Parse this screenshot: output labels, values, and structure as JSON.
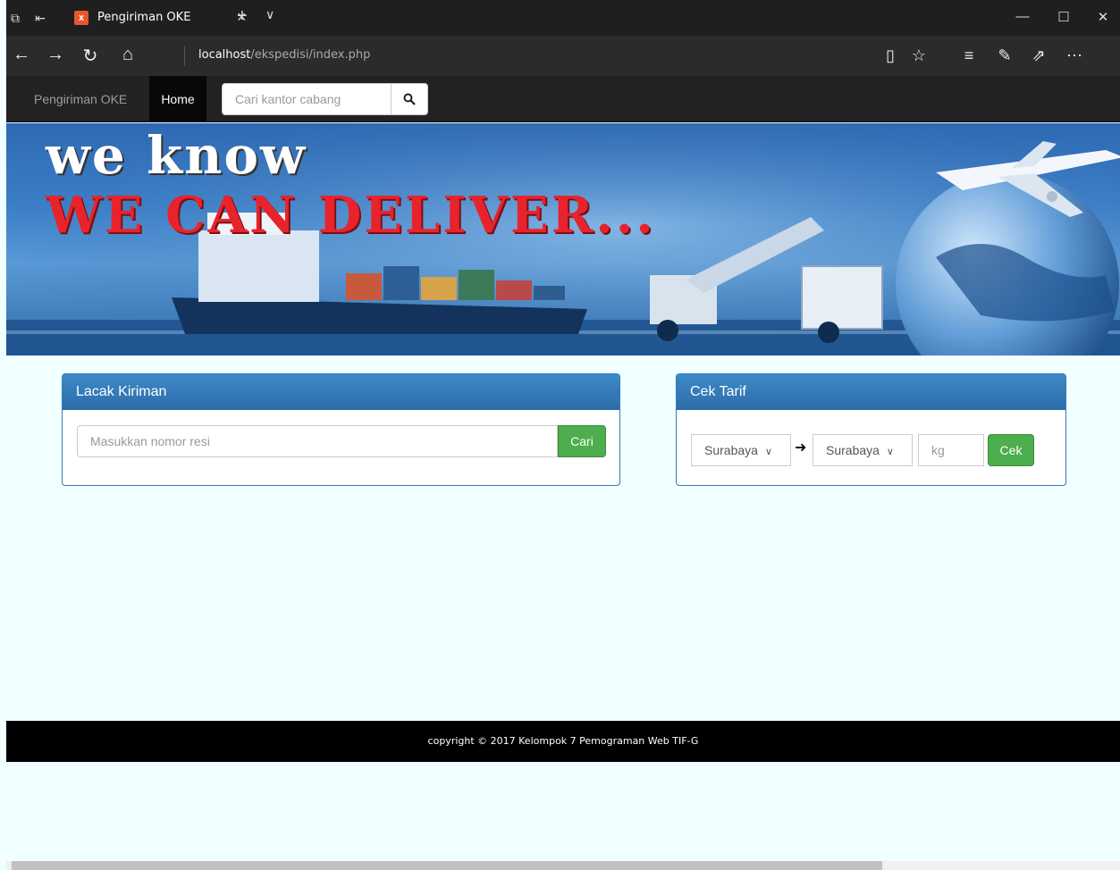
{
  "browser": {
    "tab_title": "Pengiriman OKE",
    "tab_close_icon": "×",
    "new_tab_icon": "+",
    "url_host": "localhost",
    "url_path": "/ekspedisi/index.php"
  },
  "navbar": {
    "brand": "Pengiriman OKE",
    "home": "Home",
    "search_placeholder": "Cari kantor cabang"
  },
  "banner": {
    "line1": "we know",
    "line2": "WE CAN DELIVER..."
  },
  "lacak": {
    "title": "Lacak Kiriman",
    "placeholder": "Masukkan nomor resi",
    "button": "Cari"
  },
  "tarif": {
    "title": "Cek Tarif",
    "from": "Surabaya",
    "to": "Surabaya",
    "weight_placeholder": "kg",
    "button": "Cek"
  },
  "footer": {
    "text": "copyright © 2017 Kelompok 7 Pemograman Web TIF-G"
  },
  "colors": {
    "accent": "#337ab7",
    "success": "#4cae4c",
    "navbar": "#222222",
    "banner_red": "#e8232c"
  }
}
